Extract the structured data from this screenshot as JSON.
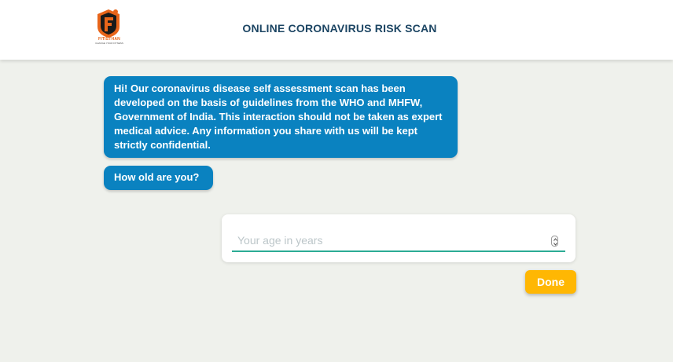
{
  "header": {
    "title": "ONLINE CORONAVIRUS RISK SCAN",
    "logo": {
      "icon": "f-badge-logo",
      "brand_text": "FITISTHAN",
      "tagline": "CHANGE YOUR FITNESS"
    }
  },
  "chat": {
    "messages": [
      "Hi! Our coronavirus disease self assessment scan has been developed on the basis of guidelines from the WHO and MHFW, Government of India. This interaction should not be taken as expert medical advice. Any information you share with us will be kept strictly confidential.",
      "How old are you?"
    ]
  },
  "age_input": {
    "placeholder": "Your age in years",
    "value": ""
  },
  "actions": {
    "done_label": "Done"
  },
  "colors": {
    "bubble": "#0a82c0",
    "accent_line": "#2bab94",
    "done_button": "#ffb703",
    "title": "#1c4563",
    "logo_orange": "#e8651a"
  }
}
